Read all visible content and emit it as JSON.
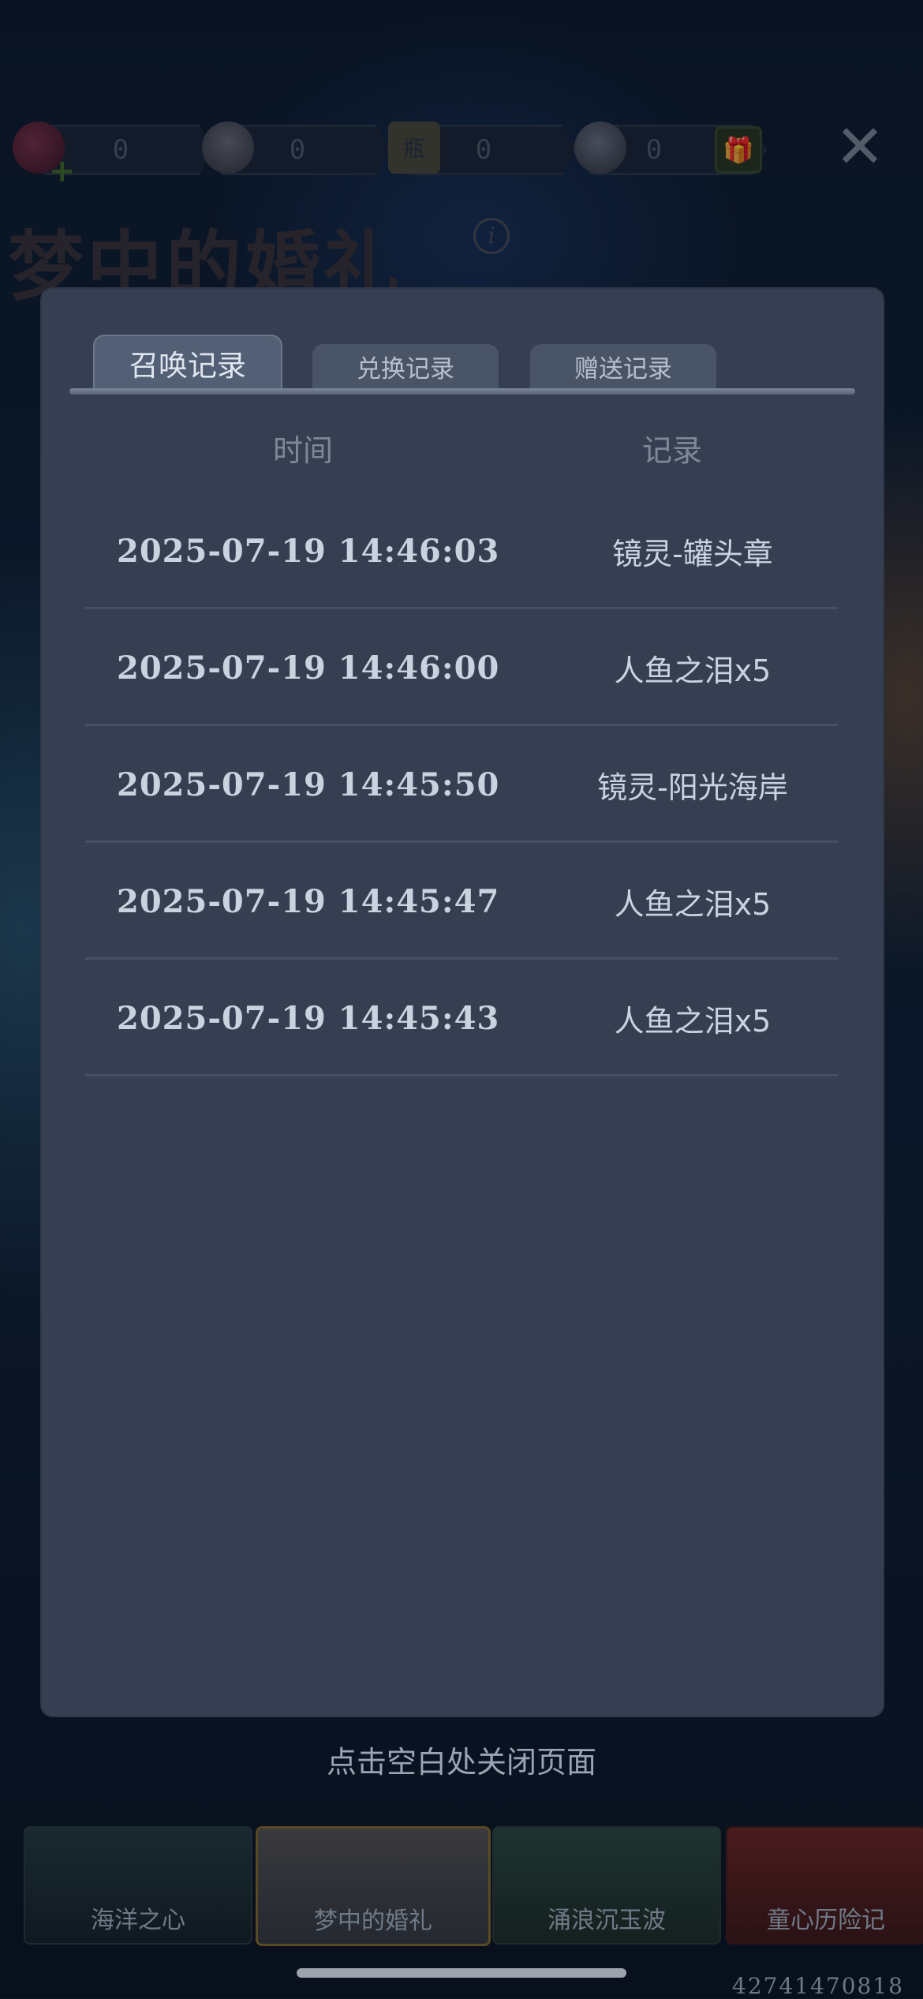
{
  "resources": [
    {
      "icon": "candy-icon",
      "count": "0"
    },
    {
      "icon": "shell-icon",
      "count": "0"
    },
    {
      "icon": "ticket-icon",
      "count": "0",
      "badge": "瓶"
    },
    {
      "icon": "pearl-icon",
      "count": "0"
    }
  ],
  "header": {
    "title": "梦中的婚礼",
    "close_label": "✕",
    "gift_label": "🎁",
    "info_label": "i"
  },
  "tabs": [
    {
      "label": "召唤记录"
    },
    {
      "label": "兑换记录"
    },
    {
      "label": "赠送记录"
    }
  ],
  "table": {
    "headers": {
      "time": "时间",
      "record": "记录"
    },
    "rows": [
      {
        "time": "2025-07-19 14:46:03",
        "record": "镜灵-罐头章"
      },
      {
        "time": "2025-07-19 14:46:00",
        "record": "人鱼之泪x5"
      },
      {
        "time": "2025-07-19 14:45:50",
        "record": "镜灵-阳光海岸"
      },
      {
        "time": "2025-07-19 14:45:47",
        "record": "人鱼之泪x5"
      },
      {
        "time": "2025-07-19 14:45:43",
        "record": "人鱼之泪x5"
      }
    ]
  },
  "hint": "点击空白处关闭页面",
  "bottom_tabs": [
    {
      "label": "海洋之心"
    },
    {
      "label": "梦中的婚礼"
    },
    {
      "label": "涌浪沉玉波"
    },
    {
      "label": "童心历险记"
    }
  ],
  "uid": "42741470818"
}
